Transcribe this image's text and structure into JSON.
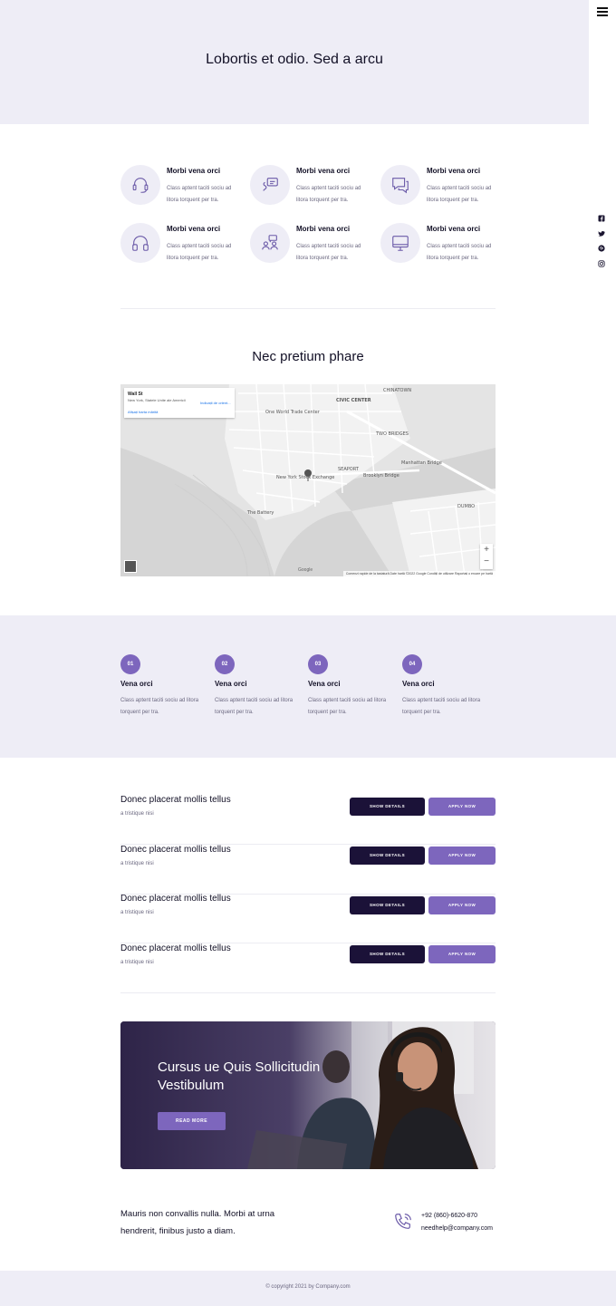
{
  "hero": {
    "title": "Lobortis et odio. Sed a arcu"
  },
  "side": {
    "icons": [
      "facebook-icon",
      "twitter-icon",
      "pinterest-icon",
      "instagram-icon"
    ]
  },
  "features": [
    {
      "icon": "headset-icon",
      "title": "Morbi vena orci",
      "desc": "Class aptent taciti sociu ad litora torquent per tra."
    },
    {
      "icon": "chat-icon",
      "title": "Morbi vena orci",
      "desc": "Class aptent taciti sociu ad litora torquent per tra."
    },
    {
      "icon": "messages-icon",
      "title": "Morbi vena orci",
      "desc": "Class aptent taciti sociu ad litora torquent per tra."
    },
    {
      "icon": "headphones-icon",
      "title": "Morbi vena orci",
      "desc": "Class aptent taciti sociu ad litora torquent per tra."
    },
    {
      "icon": "team-chat-icon",
      "title": "Morbi vena orci",
      "desc": "Class aptent taciti sociu ad litora torquent per tra."
    },
    {
      "icon": "monitor-icon",
      "title": "Morbi vena orci",
      "desc": "Class aptent taciti sociu ad litora torquent per tra."
    }
  ],
  "map": {
    "title": "Nec pretium phare",
    "card_title": "Wall St",
    "card_subtitle": "New York, Statele Unite ale Americii",
    "card_link": "Afișați harta mărită",
    "card_directions": "Indicații de orient...",
    "labels": [
      "CIVIC CENTER",
      "CHINATOWN",
      "TWO BRIDGES",
      "SEAPORT",
      "DUMBO",
      "Brooklyn Bridge",
      "The Battery",
      "New York Stock Exchange",
      "One World Trade Center",
      "Manhattan Bridge"
    ],
    "google": "Google",
    "footer": "Comenzi rapide de la tastatură   Date hartă ©2022 Google   Condiții de utilizare   Raportați o eroare pe hartă"
  },
  "steps": [
    {
      "num": "01",
      "title": "Vena orci",
      "desc": "Class aptent taciti sociu ad litora torquent per tra."
    },
    {
      "num": "02",
      "title": "Vena orci",
      "desc": "Class aptent taciti sociu ad litora torquent per tra."
    },
    {
      "num": "03",
      "title": "Vena orci",
      "desc": "Class aptent taciti sociu ad litora torquent per tra."
    },
    {
      "num": "04",
      "title": "Vena orci",
      "desc": "Class aptent taciti sociu ad litora torquent per tra."
    }
  ],
  "jobs": [
    {
      "title": "Donec placerat mollis tellus",
      "subtitle": "a tristique nisi",
      "details": "SHOW DETAILS",
      "apply": "APPLY NOW"
    },
    {
      "title": "Donec placerat mollis tellus",
      "subtitle": "a tristique nisi",
      "details": "SHOW DETAILS",
      "apply": "APPLY NOW"
    },
    {
      "title": "Donec placerat mollis tellus",
      "subtitle": "a tristique nisi",
      "details": "SHOW DETAILS",
      "apply": "APPLY NOW"
    },
    {
      "title": "Donec placerat mollis tellus",
      "subtitle": "a tristique nisi",
      "details": "SHOW DETAILS",
      "apply": "APPLY NOW"
    }
  ],
  "promo": {
    "title": "Cursus ue Quis Sollicitudin Vestibulum",
    "button": "READ MORE"
  },
  "contact": {
    "text": "Mauris non convallis nulla. Morbi at urna hendrerit, finibus justo a diam.",
    "phone": "+92 (860)-6620-870",
    "email": "needhelp@company.com"
  },
  "footer": {
    "copyright": "© copyright 2021 by Company.com"
  },
  "colors": {
    "accent": "#7d66bd",
    "dark": "#1b1238",
    "band": "#eeedf6"
  }
}
